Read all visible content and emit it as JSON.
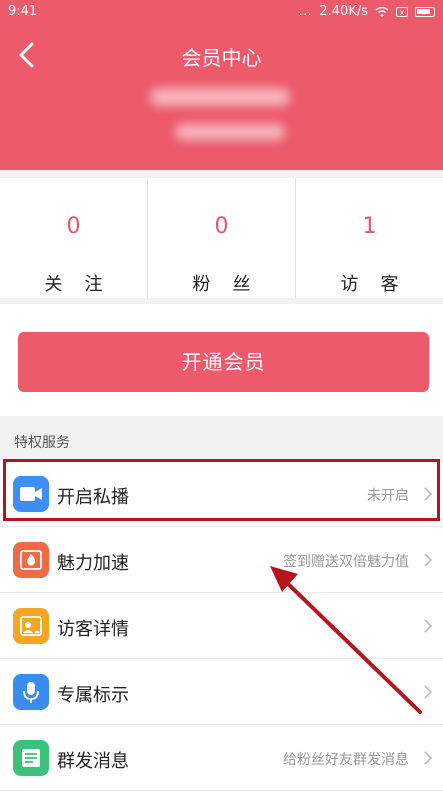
{
  "status": {
    "time": "9:41",
    "dots": "...",
    "speed": "2.40K/s",
    "sim": "x"
  },
  "header": {
    "title": "会员中心"
  },
  "stats": [
    {
      "value": "0",
      "label": "关注"
    },
    {
      "value": "0",
      "label": "粉丝"
    },
    {
      "value": "1",
      "label": "访客"
    }
  ],
  "open_button": "开通会员",
  "section_title": "特权服务",
  "services": [
    {
      "label": "开启私播",
      "value": "未开启",
      "icon": "video-camera-icon",
      "color": "#3e8ef7"
    },
    {
      "label": "魅力加速",
      "value": "签到赠送双倍魅力值",
      "icon": "fire-icon",
      "color": "#f26a43"
    },
    {
      "label": "访客详情",
      "value": "",
      "icon": "visitor-card-icon",
      "color": "#f5a623"
    },
    {
      "label": "专属标示",
      "value": "",
      "icon": "microphone-icon",
      "color": "#3a8df0"
    },
    {
      "label": "群发消息",
      "value": "给粉丝好友群发消息",
      "icon": "message-icon",
      "color": "#3cc07a"
    }
  ],
  "colors": {
    "brand": "#ec5a6c",
    "highlight": "#b4151f"
  }
}
